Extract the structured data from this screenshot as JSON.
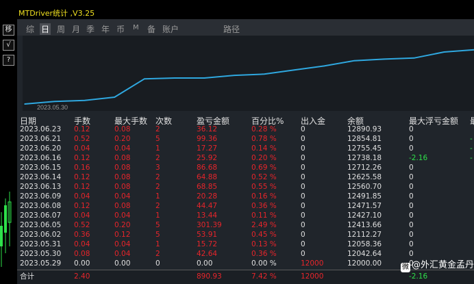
{
  "leftbar": {
    "buttons": [
      "移",
      "√",
      "?"
    ]
  },
  "window": {
    "title": "MTDriver统计 ,V3.25"
  },
  "tabs": [
    "综",
    "日",
    "周",
    "月",
    "季",
    "年",
    "币",
    "M",
    "备",
    "账户",
    "路径"
  ],
  "active_tab": "日",
  "chart": {
    "xlabel_first": "2023.05.30"
  },
  "chart_data": {
    "type": "line",
    "x": [
      "2023.05.29",
      "2023.05.30",
      "2023.05.31",
      "2023.06.02",
      "2023.06.05",
      "2023.06.06",
      "2023.06.07",
      "2023.06.08",
      "2023.06.09",
      "2023.06.13",
      "2023.06.14",
      "2023.06.15",
      "2023.06.16",
      "2023.06.20",
      "2023.06.21",
      "2023.06.23"
    ],
    "series": [
      {
        "values": [
          12000.0,
          12042.64,
          12058.36,
          12112.27,
          12413.66,
          12427.1,
          12427.1,
          12471.57,
          12491.85,
          12560.7,
          12625.58,
          12712.26,
          12738.18,
          12755.45,
          12854.81,
          12890.93
        ]
      }
    ],
    "ylim": [
      12000,
      12900
    ],
    "colors": {
      "line": "#2fa8e0"
    }
  },
  "table": {
    "headers": [
      "日期",
      "手数",
      "最大手数",
      "次数",
      "盈亏金额",
      "百分比%",
      "出入金",
      "余额",
      "最大浮亏金额",
      "最"
    ],
    "rows": [
      [
        "2023.06.23",
        "0.12",
        "0.08",
        "2",
        "36.12",
        "0.28 %",
        "0",
        "12890.93",
        "0",
        ""
      ],
      [
        "2023.06.21",
        "0.52",
        "0.20",
        "5",
        "99.36",
        "0.78 %",
        "0",
        "12854.81",
        "0",
        "-"
      ],
      [
        "2023.06.20",
        "0.04",
        "0.04",
        "1",
        "17.27",
        "0.14 %",
        "0",
        "12755.45",
        "0",
        "-"
      ],
      [
        "2023.06.16",
        "0.12",
        "0.08",
        "2",
        "25.92",
        "0.20 %",
        "0",
        "12738.18",
        "-2.16",
        "-"
      ],
      [
        "2023.06.15",
        "0.16",
        "0.08",
        "3",
        "86.68",
        "0.69 %",
        "0",
        "12712.26",
        "0",
        ""
      ],
      [
        "2023.06.14",
        "0.12",
        "0.08",
        "2",
        "64.88",
        "0.52 %",
        "0",
        "12625.58",
        "0",
        ""
      ],
      [
        "2023.06.13",
        "0.12",
        "0.08",
        "2",
        "68.85",
        "0.55 %",
        "0",
        "12560.70",
        "0",
        ""
      ],
      [
        "2023.06.09",
        "0.04",
        "0.04",
        "1",
        "20.28",
        "0.16 %",
        "0",
        "12491.85",
        "0",
        ""
      ],
      [
        "2023.06.08",
        "0.12",
        "0.08",
        "2",
        "44.47",
        "0.36 %",
        "0",
        "12471.57",
        "0",
        ""
      ],
      [
        "2023.06.07",
        "0.04",
        "0.04",
        "1",
        "13.44",
        "0.11 %",
        "0",
        "12427.10",
        "0",
        ""
      ],
      [
        "2023.06.05",
        "0.52",
        "0.20",
        "5",
        "301.39",
        "2.49 %",
        "0",
        "12413.66",
        "0",
        ""
      ],
      [
        "2023.06.02",
        "0.36",
        "0.12",
        "5",
        "53.91",
        "0.45 %",
        "0",
        "12112.27",
        "0",
        ""
      ],
      [
        "2023.05.31",
        "0.04",
        "0.04",
        "1",
        "15.72",
        "0.13 %",
        "0",
        "12058.36",
        "0",
        ""
      ],
      [
        "2023.05.30",
        "0.08",
        "0.04",
        "2",
        "42.64",
        "0.36 %",
        "0",
        "12042.64",
        "0",
        ""
      ],
      [
        "2023.05.29",
        "0.00",
        "0.00",
        "0",
        "0.00",
        "0.00 %",
        "12000",
        "12000.00",
        "0",
        ""
      ]
    ],
    "total": [
      "合计",
      "2.40",
      "",
      "",
      "890.93",
      "7.42 %",
      "12000",
      "",
      "-2.16",
      ""
    ]
  },
  "watermark": {
    "icon": "微",
    "text": "@外汇黄金孟丹"
  },
  "colors": {
    "profit": "#e8252b",
    "normal": "#e0e0e0",
    "negative": "#2ee04a",
    "title": "#f0e020"
  }
}
